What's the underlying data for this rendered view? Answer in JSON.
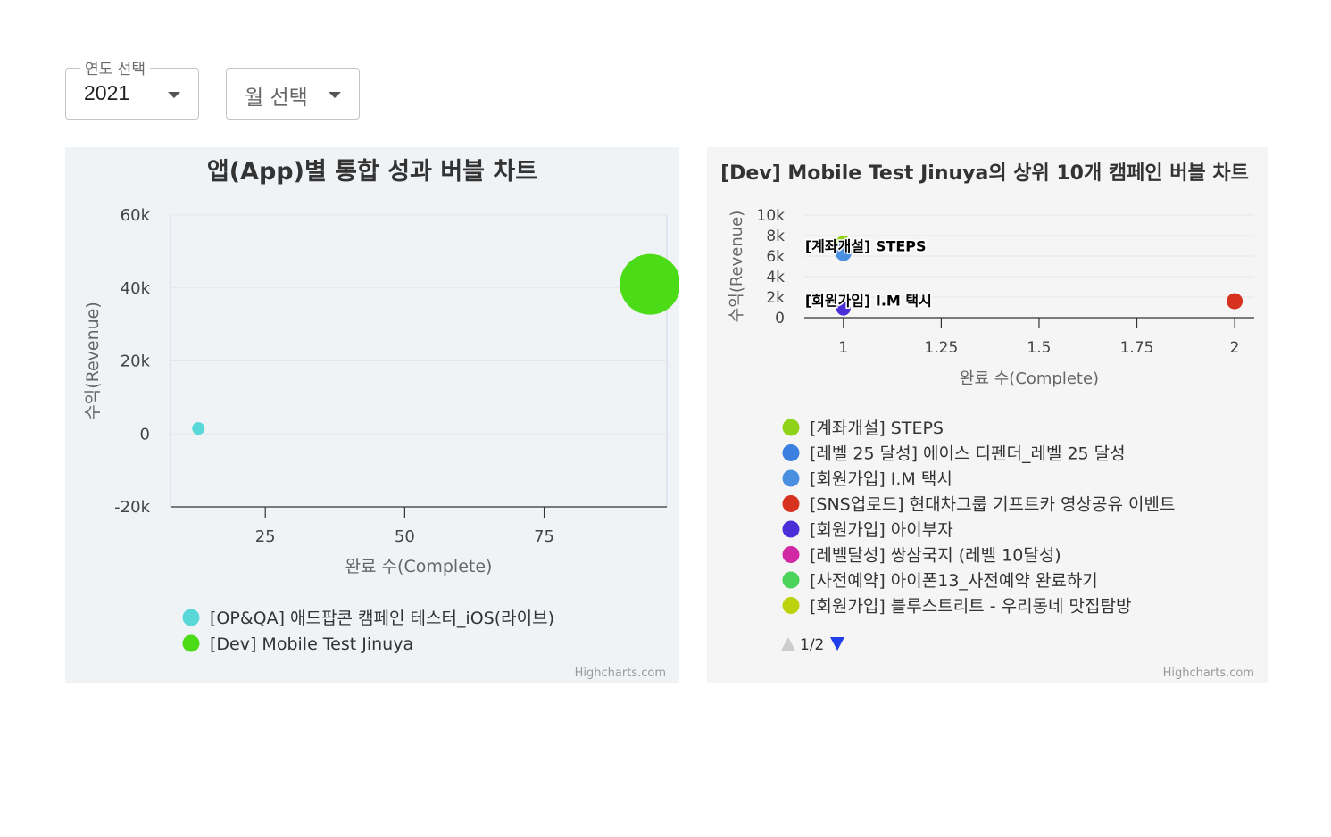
{
  "filters": {
    "year": {
      "label": "연도 선택",
      "value": "2021"
    },
    "month": {
      "placeholder": "월 선택"
    }
  },
  "credits": "Highcharts.com",
  "chart_data": [
    {
      "type": "scatter",
      "title": "앱(App)별 통합 성과 버블 차트",
      "xlabel": "완료 수(Complete)",
      "ylabel": "수익(Revenue)",
      "xlim": [
        8,
        97
      ],
      "ylim": [
        -20000,
        60000
      ],
      "x_ticks": [
        25,
        50,
        75
      ],
      "x_tick_labels": [
        "25",
        "50",
        "75"
      ],
      "y_ticks": [
        -20000,
        0,
        20000,
        40000,
        60000
      ],
      "y_tick_labels": [
        "-20k",
        "0",
        "20k",
        "40k",
        "60k"
      ],
      "grid": true,
      "legend_position": "bottom",
      "series": [
        {
          "name": "[OP&QA] 애드팝콘 캠페인 테스터_iOS(라이브)",
          "color": "#5ad7d8",
          "points": [
            {
              "x": 13,
              "y": 1500,
              "size": 7
            }
          ]
        },
        {
          "name": "[Dev] Mobile Test Jinuya",
          "color": "#4cdb17",
          "points": [
            {
              "x": 94,
              "y": 41000,
              "size": 34
            }
          ]
        }
      ]
    },
    {
      "type": "scatter",
      "title": "[Dev] Mobile Test Jinuya의 상위 10개 캠페인 버블 차트",
      "xlabel": "완료 수(Complete)",
      "ylabel": "수익(Revenue)",
      "xlim": [
        0.9,
        2.05
      ],
      "ylim": [
        0,
        10000
      ],
      "x_ticks": [
        1,
        1.25,
        1.5,
        1.75,
        2
      ],
      "x_tick_labels": [
        "1",
        "1.25",
        "1.5",
        "1.75",
        "2"
      ],
      "y_ticks": [
        0,
        2000,
        4000,
        6000,
        8000,
        10000
      ],
      "y_tick_labels": [
        "0",
        "2k",
        "4k",
        "6k",
        "8k",
        "10k"
      ],
      "grid": true,
      "legend_position": "bottom",
      "legend_page": "1/2",
      "data_labels": [
        {
          "text": "[계좌개설] STEPS",
          "x": 1,
          "y": 7000
        },
        {
          "text": "[회원가입] I.M 택시",
          "x": 1,
          "y": 1700
        }
      ],
      "series": [
        {
          "name": "[계좌개설] STEPS",
          "color": "#8fd318",
          "points": [
            {
              "x": 1,
              "y": 7200,
              "size": 9
            }
          ]
        },
        {
          "name": "[레벨 25 달성] 에이스 디펜더_레벨 25 달성",
          "color": "#3b7fe0",
          "points": [
            {
              "x": 1,
              "y": 6500,
              "size": 9
            }
          ]
        },
        {
          "name": "[회원가입] I.M 택시",
          "color": "#4a8fe0",
          "points": [
            {
              "x": 1,
              "y": 6300,
              "size": 9
            }
          ]
        },
        {
          "name": "[SNS업로드] 현대차그룹 기프트카 영상공유 이벤트",
          "color": "#d6321f",
          "points": [
            {
              "x": 2,
              "y": 1600,
              "size": 9
            }
          ]
        },
        {
          "name": "[회원가입] 아이부자",
          "color": "#4a2fd8",
          "points": [
            {
              "x": 1,
              "y": 900,
              "size": 8
            }
          ]
        },
        {
          "name": "[레벨달성] 쌍삼국지 (레벨 10달성)",
          "color": "#d22aa4"
        },
        {
          "name": "[사전예약] 아이폰13_사전예약 완료하기",
          "color": "#4cd45a"
        },
        {
          "name": "[회원가입] 블루스트리트 - 우리동네 맛집탐방",
          "color": "#bcd30c"
        }
      ]
    }
  ]
}
